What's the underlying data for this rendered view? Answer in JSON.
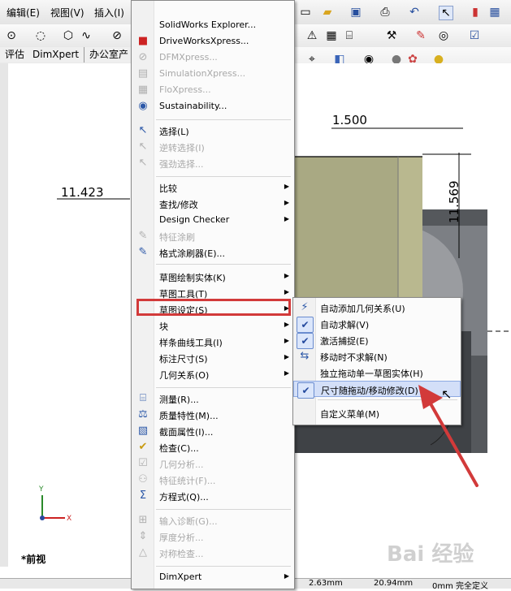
{
  "menubar": {
    "items": [
      "编辑(E)",
      "视图(V)",
      "插入(I)"
    ]
  },
  "tabs": [
    "评估",
    "DimXpert",
    "办公室产"
  ],
  "canvas": {
    "dimensions": [
      "1.500",
      "11.423",
      "11.569"
    ],
    "view_label": "*前视",
    "axis_x": "X",
    "axis_y": "Y"
  },
  "status": {
    "values": [
      "2.63mm",
      "20.94mm",
      "0mm 完全定义"
    ]
  },
  "context_menu": {
    "items": [
      {
        "label": "SolidWorks Explorer...",
        "icon": "",
        "disabled": false,
        "arrow": false
      },
      {
        "label": "DriveWorksXpress...",
        "icon": "driveworks-icon",
        "disabled": false,
        "arrow": false
      },
      {
        "label": "DFMXpress...",
        "icon": "dfm-icon",
        "disabled": true,
        "arrow": false
      },
      {
        "label": "SimulationXpress...",
        "icon": "simulation-icon",
        "disabled": true,
        "arrow": false
      },
      {
        "label": "FloXpress...",
        "icon": "flo-icon",
        "disabled": true,
        "arrow": false
      },
      {
        "label": "Sustainability...",
        "icon": "sustainability-icon",
        "disabled": false,
        "arrow": false
      },
      {
        "label": "选择(L)",
        "icon": "cursor-icon",
        "disabled": false,
        "arrow": false
      },
      {
        "label": "逆转选择(I)",
        "icon": "invert-selection-icon",
        "disabled": true,
        "arrow": false
      },
      {
        "label": "强劲选择...",
        "icon": "power-select-icon",
        "disabled": true,
        "arrow": false
      },
      {
        "label": "比较",
        "icon": "",
        "disabled": false,
        "arrow": true
      },
      {
        "label": "查找/修改",
        "icon": "",
        "disabled": false,
        "arrow": true
      },
      {
        "label": "Design Checker",
        "icon": "",
        "disabled": false,
        "arrow": true
      },
      {
        "label": "特征涂刷",
        "icon": "feature-paint-icon",
        "disabled": true,
        "arrow": false
      },
      {
        "label": "格式涂刷器(E)...",
        "icon": "format-painter-icon",
        "disabled": false,
        "arrow": false
      },
      {
        "label": "草图绘制实体(K)",
        "icon": "",
        "disabled": false,
        "arrow": true
      },
      {
        "label": "草图工具(T)",
        "icon": "",
        "disabled": false,
        "arrow": true
      },
      {
        "label": "草图设定(S)",
        "icon": "",
        "disabled": false,
        "arrow": true
      },
      {
        "label": "块",
        "icon": "",
        "disabled": false,
        "arrow": true
      },
      {
        "label": "样条曲线工具(I)",
        "icon": "",
        "disabled": false,
        "arrow": true
      },
      {
        "label": "标注尺寸(S)",
        "icon": "",
        "disabled": false,
        "arrow": true
      },
      {
        "label": "几何关系(O)",
        "icon": "",
        "disabled": false,
        "arrow": true
      },
      {
        "label": "测量(R)...",
        "icon": "measure-icon",
        "disabled": false,
        "arrow": false
      },
      {
        "label": "质量特性(M)...",
        "icon": "mass-properties-icon",
        "disabled": false,
        "arrow": false
      },
      {
        "label": "截面属性(I)...",
        "icon": "section-properties-icon",
        "disabled": false,
        "arrow": false
      },
      {
        "label": "检查(C)...",
        "icon": "check-icon",
        "disabled": false,
        "arrow": false
      },
      {
        "label": "几何分析...",
        "icon": "geometry-analysis-icon",
        "disabled": true,
        "arrow": false
      },
      {
        "label": "特征统计(F)...",
        "icon": "feature-statistics-icon",
        "disabled": true,
        "arrow": false
      },
      {
        "label": "方程式(Q)...",
        "icon": "sigma-icon",
        "disabled": false,
        "arrow": false
      },
      {
        "label": "输入诊断(G)...",
        "icon": "import-diagnostics-icon",
        "disabled": true,
        "arrow": false
      },
      {
        "label": "厚度分析...",
        "icon": "thickness-icon",
        "disabled": true,
        "arrow": false
      },
      {
        "label": "对称检查...",
        "icon": "symmetry-icon",
        "disabled": true,
        "arrow": false
      },
      {
        "label": "DimXpert",
        "icon": "",
        "disabled": false,
        "arrow": true
      }
    ]
  },
  "submenu": {
    "items": [
      {
        "label": "自动添加几何关系(U)",
        "checked": false,
        "icon": "auto-relations-icon"
      },
      {
        "label": "自动求解(V)",
        "checked": true,
        "icon": "checkmark-icon"
      },
      {
        "label": "激活捕捉(E)",
        "checked": true,
        "icon": "checkmark-icon"
      },
      {
        "label": "移动时不求解(N)",
        "checked": false,
        "icon": "no-solve-icon"
      },
      {
        "label": "独立拖动单一草图实体(H)",
        "checked": false,
        "icon": ""
      },
      {
        "label": "尺寸随拖动/移动修改(D)",
        "checked": true,
        "icon": "checkmark-icon"
      },
      {
        "label": "自定义菜单(M)",
        "checked": false,
        "icon": ""
      }
    ]
  },
  "watermark": "Bai 经验",
  "colors": {
    "highlight_red": "#d23a3a",
    "part_fill": "#b9b88f",
    "menu_hover": "#d3dff8"
  }
}
